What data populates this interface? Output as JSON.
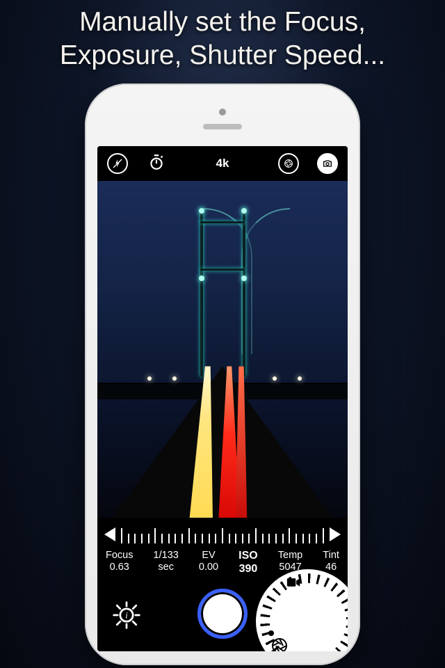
{
  "marketing": {
    "headline": "Manually set the Focus,\nExposure, Shutter Speed..."
  },
  "topbar": {
    "resolution": "4k"
  },
  "slider": {
    "tick_count": 31
  },
  "params": [
    {
      "label": "Focus",
      "value": "0.63",
      "selected": false
    },
    {
      "label": "1/133",
      "value": "sec",
      "selected": false
    },
    {
      "label": "EV",
      "value": "0.00",
      "selected": false
    },
    {
      "label": "ISO",
      "value": "390",
      "selected": true
    },
    {
      "label": "Temp",
      "value": "5047",
      "selected": false
    },
    {
      "label": "Tint",
      "value": "46",
      "selected": false
    }
  ],
  "icons": {
    "flash": "flash-off-icon",
    "timer": "timer-icon",
    "aperture": "aperture-icon",
    "camera": "camera-switch-icon",
    "settings": "gear-info-icon",
    "dial_video": "video-icon",
    "dial_aperture": "aperture-icon"
  }
}
